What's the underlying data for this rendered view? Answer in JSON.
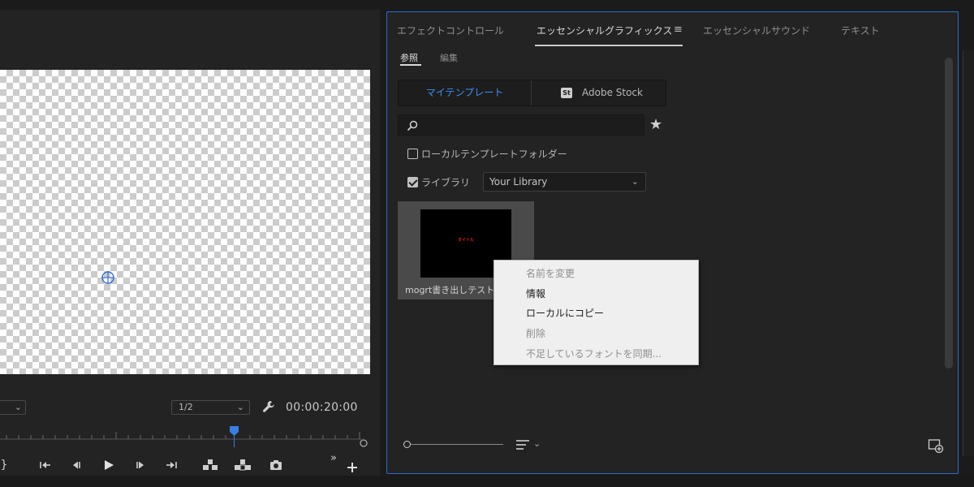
{
  "monitor": {
    "resolution_value": "1/2",
    "timecode": "00:00:20:00",
    "transport_icons": [
      "mark-out-icon",
      "go-to-in-icon",
      "step-back-icon",
      "play-icon",
      "step-forward-icon",
      "go-to-out-icon",
      "lift-icon",
      "extract-icon",
      "export-frame-icon",
      "more-icon",
      "add-button-icon"
    ]
  },
  "panel": {
    "tabs": [
      {
        "label": "エフェクトコントロール",
        "active": false
      },
      {
        "label": "エッセンシャルグラフィックス",
        "active": true
      },
      {
        "label": "エッセンシャルサウンド",
        "active": false
      },
      {
        "label": "テキスト",
        "active": false
      }
    ],
    "subtabs": [
      {
        "label": "参照",
        "active": true
      },
      {
        "label": "編集",
        "active": false
      }
    ],
    "segment": {
      "my_templates": "マイテンプレート",
      "stock_badge": "St",
      "adobe_stock": "Adobe Stock"
    },
    "search": {
      "value": "",
      "placeholder": ""
    },
    "local_folder": {
      "label": "ローカルテンプレートフォルダー",
      "checked": false
    },
    "library": {
      "label": "ライブラリ",
      "checked": true,
      "selected": "Your Library"
    },
    "template": {
      "thumb_text": "タイトル",
      "label": "mogrt書き出しテスト"
    },
    "context_menu": [
      {
        "label": "名前を変更",
        "enabled": false
      },
      {
        "label": "情報",
        "enabled": true
      },
      {
        "label": "ローカルにコピー",
        "enabled": true
      },
      {
        "label": "削除",
        "enabled": false
      },
      {
        "label": "不足しているフォントを同期...",
        "enabled": false
      }
    ]
  },
  "colors": {
    "accent": "#2d6bd2",
    "selected_text": "#3d8ef0",
    "playhead": "#3a7fe0",
    "thumbnail_title": "#e02020"
  }
}
